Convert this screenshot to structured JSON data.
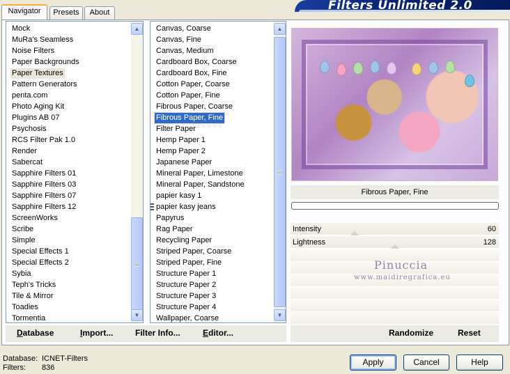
{
  "tabs": [
    {
      "label": "Navigator",
      "active": true
    },
    {
      "label": "Presets",
      "active": false
    },
    {
      "label": "About",
      "active": false
    }
  ],
  "header": {
    "title": "Filters Unlimited 2.0"
  },
  "categories": {
    "items": [
      "Mock",
      "MuRa's Seamless",
      "Noise Filters",
      "Paper Backgrounds",
      "Paper Textures",
      "Pattern Generators",
      "penta.com",
      "Photo Aging Kit",
      "Plugins AB 07",
      "Psychosis",
      "RCS Filter Pak 1.0",
      "Render",
      "Sabercat",
      "Sapphire Filters 01",
      "Sapphire Filters 03",
      "Sapphire Filters 07",
      "Sapphire Filters 12",
      "ScreenWorks",
      "Scribe",
      "Simple",
      "Special Effects 1",
      "Special Effects 2",
      "Sybia",
      "Teph's Tricks",
      "Tile & Mirror",
      "Toadies",
      "Tormentia"
    ],
    "selected": "Paper Textures"
  },
  "filters": {
    "items": [
      "Canvas, Coarse",
      "Canvas, Fine",
      "Canvas, Medium",
      "Cardboard Box, Coarse",
      "Cardboard Box, Fine",
      "Cotton Paper, Coarse",
      "Cotton Paper, Fine",
      "Fibrous Paper, Coarse",
      "Fibrous Paper, Fine",
      "Filter Paper",
      "Hemp Paper 1",
      "Hemp Paper 2",
      "Japanese Paper",
      "Mineral Paper, Limestone",
      "Mineral Paper, Sandstone",
      "papier kasy 1",
      "papier kasy jeans",
      "Papyrus",
      "Rag Paper",
      "Recycling Paper",
      "Striped Paper, Coarse",
      "Striped Paper, Fine",
      "Structure Paper 1",
      "Structure Paper 2",
      "Structure Paper 3",
      "Structure Paper 4",
      "Wallpaper, Coarse"
    ],
    "selected": "Fibrous Paper, Fine"
  },
  "preview": {
    "filter_name": "Fibrous Paper, Fine",
    "watermark_name": "Pinuccia",
    "watermark_url": "www.maidiregrafica.eu"
  },
  "params": [
    {
      "label": "Intensity",
      "value": "60",
      "level": 0.235
    },
    {
      "label": "Lightness",
      "value": "128",
      "level": 0.5
    }
  ],
  "left_bar": {
    "database": {
      "underline": "D",
      "rest": "atabase"
    },
    "import": {
      "underline": "I",
      "rest": "mport..."
    },
    "filter_info": {
      "underline": "",
      "rest": "Filter Info..."
    },
    "editor": {
      "underline": "E",
      "rest": "ditor..."
    }
  },
  "right_bar": {
    "randomize": "Randomize",
    "reset": "Reset"
  },
  "footer": {
    "database_label": "Database:",
    "database_value": "ICNET-Filters",
    "filters_label": "Filters:",
    "filters_value": "836"
  },
  "buttons": {
    "apply": "Apply",
    "cancel": "Cancel",
    "help": "Help"
  },
  "icons": {
    "scroll_up": "chevron-up-icon",
    "scroll_down": "chevron-down-icon"
  }
}
